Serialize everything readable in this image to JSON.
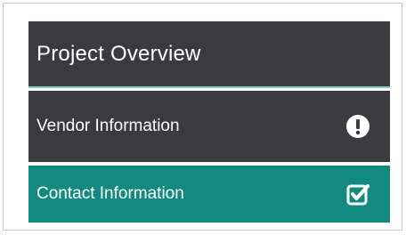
{
  "nav": {
    "items": [
      {
        "label": "Project Overview",
        "icon": null,
        "state": "header"
      },
      {
        "label": "Vendor Information",
        "icon": "exclamation-circle-icon",
        "state": "warning"
      },
      {
        "label": "Contact Information",
        "icon": "checkbox-checked-icon",
        "state": "complete",
        "active": true
      }
    ]
  },
  "colors": {
    "dark_panel": "#3b3b3f",
    "active_teal": "#128a80",
    "accent_line": "#7fd0c6",
    "text": "#ffffff"
  }
}
